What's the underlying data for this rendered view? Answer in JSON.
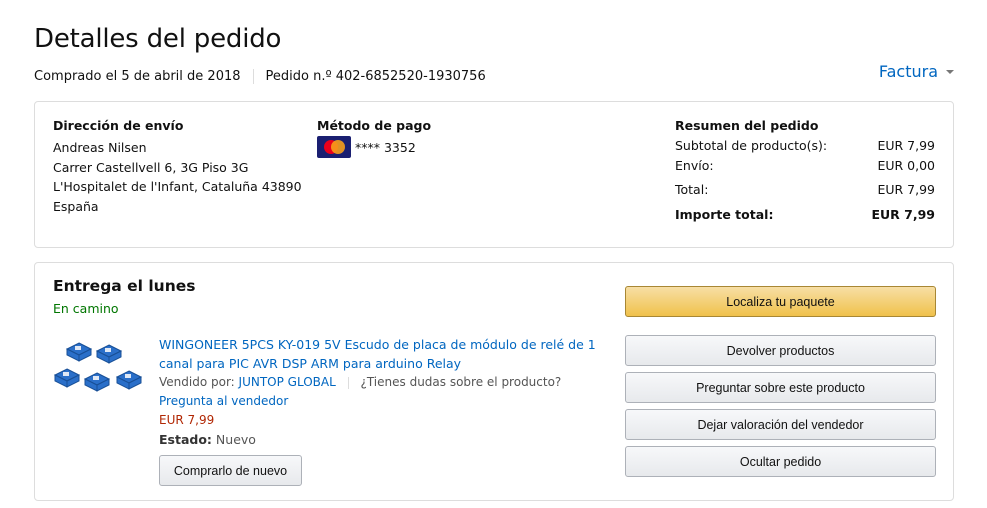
{
  "header": {
    "title": "Detalles del pedido",
    "purchased": "Comprado el 5 de abril de 2018",
    "order_number": "Pedido n.º 402-6852520-1930756",
    "invoice_label": "Factura"
  },
  "summary_box": {
    "shipping": {
      "heading": "Dirección de envío",
      "lines": [
        "Andreas Nilsen",
        "Carrer Castellvell 6, 3G Piso 3G",
        "L'Hospitalet de l'Infant, Cataluña 43890",
        "España"
      ]
    },
    "payment": {
      "heading": "Método de pago",
      "card_icon": "mastercard-icon",
      "card_text": "**** 3352"
    },
    "order_summary": {
      "heading": "Resumen del pedido",
      "rows": [
        {
          "label": "Subtotal de producto(s):",
          "value": "EUR 7,99"
        },
        {
          "label": "Envío:",
          "value": "EUR 0,00"
        },
        {
          "label": "Total:",
          "value": "EUR 7,99"
        },
        {
          "label": "Importe total:",
          "value": "EUR 7,99"
        }
      ]
    }
  },
  "delivery": {
    "heading": "Entrega el lunes",
    "status": "En camino",
    "status_color": "#007600",
    "product": {
      "title": "WINGONEER 5PCS KY-019 5V Escudo de placa de módulo de relé de 1 canal para PIC AVR DSP ARM para arduino Relay",
      "sold_by_label": "Vendido por:",
      "seller": "JUNTOP GLOBAL",
      "question_text": "¿Tienes dudas sobre el producto?",
      "ask_link": "Pregunta al vendedor",
      "price": "EUR 7,99",
      "state_label": "Estado:",
      "state_value": "Nuevo",
      "buy_again": "Comprarlo de nuevo"
    },
    "actions": [
      "Localiza tu paquete",
      "Devolver productos",
      "Preguntar sobre este producto",
      "Dejar valoración del vendedor",
      "Ocultar pedido"
    ]
  },
  "colors": {
    "link": "#0066c0",
    "price": "#b12704",
    "primary_button": "#f0c14b"
  }
}
